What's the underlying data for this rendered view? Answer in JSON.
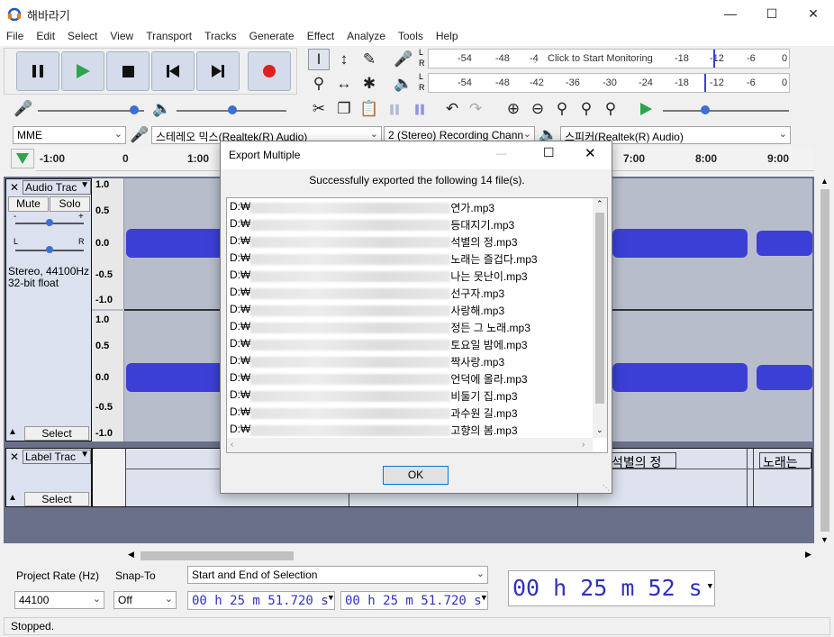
{
  "window": {
    "title": "해바라기"
  },
  "menu": [
    "File",
    "Edit",
    "Select",
    "View",
    "Transport",
    "Tracks",
    "Generate",
    "Effect",
    "Analyze",
    "Tools",
    "Help"
  ],
  "meters": {
    "record_ticks": [
      "-54",
      "-48",
      "-4̣"
    ],
    "record_hint": "Click to Start Monitoring",
    "record_ticks_right": [
      "-18",
      "-12",
      "-6",
      "0"
    ],
    "play_ticks": [
      "-54",
      "-48",
      "-42",
      "-36",
      "-30",
      "-24",
      "-18",
      "-12",
      "-6",
      "0"
    ],
    "channel_L": "L",
    "channel_R": "R"
  },
  "devices": {
    "host": "MME",
    "input": "스테레오 믹스(Realtek(R) Audio)",
    "channels": "2 (Stereo) Recording Chann",
    "output": "스피커(Realtek(R) Audio)"
  },
  "ruler": {
    "labels": [
      "-1:00",
      "0",
      "1:00",
      "7:00",
      "8:00",
      "9:00"
    ]
  },
  "audio_track": {
    "name": "Audio Trac",
    "mute": "Mute",
    "solo": "Solo",
    "info_line1": "Stereo, 44100Hz",
    "info_line2": "32-bit float",
    "select": "Select",
    "scale": [
      "1.0",
      "0.5",
      "0.0",
      "-0.5",
      "-1.0"
    ],
    "gain_minus": "-",
    "gain_plus": "+",
    "pan_L": "L",
    "pan_R": "R"
  },
  "label_track": {
    "name": "Label Trac",
    "select": "Select",
    "labels": [
      "석별의 정",
      "노래는"
    ]
  },
  "dialog": {
    "title": "Export Multiple",
    "message": "Successfully exported the following 14 file(s).",
    "drive_prefix": "D:₩",
    "files": [
      "연가.mp3",
      "등대지기.mp3",
      "석별의 정.mp3",
      "노래는 즐겁다.mp3",
      "나는 못난이.mp3",
      "선구자.mp3",
      "사랑해.mp3",
      "정든 그 노래.mp3",
      "토요일 밤에.mp3",
      "짝사랑.mp3",
      "언덕에 올라.mp3",
      "비둘기 집.mp3",
      "과수원 길.mp3",
      "고향의 봄.mp3"
    ],
    "ok": "OK"
  },
  "selection_bar": {
    "project_rate_label": "Project Rate (Hz)",
    "project_rate": "44100",
    "snap_to_label": "Snap-To",
    "snap_to": "Off",
    "mode": "Start and End of Selection",
    "start_time": "00 h 25 m 51.720 s",
    "end_time": "00 h 25 m 51.720 s",
    "audio_position": "00 h 25 m 52 s"
  },
  "status": "Stopped.",
  "colors": {
    "waveform": "#3b3fd6",
    "play_green": "#2ea44f",
    "record_red": "#e02020",
    "track_bg": "#6a6f8a"
  }
}
